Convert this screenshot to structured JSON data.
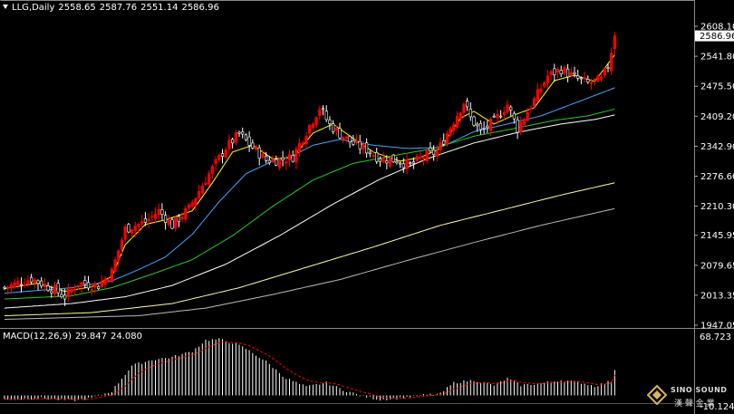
{
  "header": {
    "symbol": "LLG,Daily",
    "open": "2558.65",
    "high": "2587.76",
    "low": "2551.14",
    "close": "2586.96"
  },
  "macd_header": {
    "label": "MACD(12,26,9)",
    "macd": "29.847",
    "signal": "24.080"
  },
  "watermark": {
    "brand": "SINO SOUND",
    "sub": "漢 聲 金 業"
  },
  "colors": {
    "background": "#000000",
    "up_candle": "#ff0000",
    "down_candle": "#ffffff",
    "ma5": "#ffff00",
    "ma20": "#3fa7ff",
    "ma40": "#22cc22",
    "ma60": "#ffffff",
    "ma120": "#ffff99",
    "ma200": "#bbbbbb",
    "macd_hist": "#ffffff",
    "macd_signal": "#ff0000"
  },
  "chart_data": {
    "type": "candlestick",
    "price_axis": {
      "ticks": [
        "2608.10",
        "2541.80",
        "2475.50",
        "2409.20",
        "2342.90",
        "2276.60",
        "2210.30",
        "2145.95",
        "2079.65",
        "2013.35",
        "1947.05"
      ],
      "ylim": [
        1947.05,
        2608.1
      ]
    },
    "current_price_label": "2586.96",
    "anchors": {
      "close": [
        [
          0,
          2030
        ],
        [
          8,
          2050
        ],
        [
          15,
          2025
        ],
        [
          18,
          2010
        ],
        [
          22,
          2040
        ],
        [
          28,
          2035
        ],
        [
          32,
          2065
        ],
        [
          36,
          2160
        ],
        [
          42,
          2175
        ],
        [
          46,
          2200
        ],
        [
          50,
          2168
        ],
        [
          55,
          2205
        ],
        [
          60,
          2270
        ],
        [
          66,
          2340
        ],
        [
          70,
          2370
        ],
        [
          74,
          2340
        ],
        [
          78,
          2312
        ],
        [
          82,
          2312
        ],
        [
          86,
          2320
        ],
        [
          90,
          2375
        ],
        [
          94,
          2428
        ],
        [
          97,
          2390
        ],
        [
          100,
          2370
        ],
        [
          104,
          2348
        ],
        [
          108,
          2335
        ],
        [
          112,
          2315
        ],
        [
          117,
          2312
        ],
        [
          121,
          2300
        ],
        [
          125,
          2320
        ],
        [
          129,
          2330
        ],
        [
          133,
          2385
        ],
        [
          137,
          2440
        ],
        [
          139,
          2405
        ],
        [
          142,
          2375
        ],
        [
          146,
          2398
        ],
        [
          150,
          2435
        ],
        [
          153,
          2382
        ],
        [
          158,
          2445
        ],
        [
          162,
          2498
        ],
        [
          166,
          2513
        ],
        [
          170,
          2495
        ],
        [
          174,
          2482
        ],
        [
          178,
          2490
        ],
        [
          180,
          2520
        ],
        [
          182,
          2586.96
        ]
      ]
    },
    "ma_anchors": {
      "ma5": [
        [
          0,
          2028
        ],
        [
          10,
          2040
        ],
        [
          18,
          2022
        ],
        [
          26,
          2032
        ],
        [
          32,
          2055
        ],
        [
          36,
          2125
        ],
        [
          42,
          2170
        ],
        [
          48,
          2180
        ],
        [
          56,
          2200
        ],
        [
          62,
          2262
        ],
        [
          68,
          2330
        ],
        [
          74,
          2345
        ],
        [
          80,
          2315
        ],
        [
          86,
          2318
        ],
        [
          92,
          2372
        ],
        [
          98,
          2392
        ],
        [
          104,
          2360
        ],
        [
          110,
          2330
        ],
        [
          118,
          2310
        ],
        [
          124,
          2318
        ],
        [
          130,
          2338
        ],
        [
          136,
          2405
        ],
        [
          140,
          2420
        ],
        [
          146,
          2392
        ],
        [
          152,
          2412
        ],
        [
          158,
          2428
        ],
        [
          164,
          2488
        ],
        [
          170,
          2500
        ],
        [
          176,
          2486
        ],
        [
          182,
          2545
        ]
      ],
      "ma20": [
        [
          0,
          2018
        ],
        [
          20,
          2030
        ],
        [
          32,
          2045
        ],
        [
          40,
          2070
        ],
        [
          48,
          2098
        ],
        [
          56,
          2148
        ],
        [
          64,
          2220
        ],
        [
          72,
          2282
        ],
        [
          80,
          2310
        ],
        [
          86,
          2322
        ],
        [
          92,
          2345
        ],
        [
          100,
          2358
        ],
        [
          110,
          2345
        ],
        [
          120,
          2338
        ],
        [
          130,
          2340
        ],
        [
          140,
          2375
        ],
        [
          150,
          2392
        ],
        [
          160,
          2410
        ],
        [
          170,
          2438
        ],
        [
          182,
          2472
        ]
      ],
      "ma40": [
        [
          0,
          2005
        ],
        [
          20,
          2012
        ],
        [
          32,
          2030
        ],
        [
          44,
          2060
        ],
        [
          56,
          2092
        ],
        [
          68,
          2145
        ],
        [
          80,
          2210
        ],
        [
          92,
          2268
        ],
        [
          104,
          2305
        ],
        [
          116,
          2322
        ],
        [
          128,
          2338
        ],
        [
          140,
          2365
        ],
        [
          152,
          2382
        ],
        [
          164,
          2400
        ],
        [
          174,
          2410
        ],
        [
          182,
          2425
        ]
      ],
      "ma60": [
        [
          0,
          1985
        ],
        [
          20,
          1995
        ],
        [
          36,
          2010
        ],
        [
          50,
          2035
        ],
        [
          66,
          2082
        ],
        [
          82,
          2145
        ],
        [
          98,
          2215
        ],
        [
          112,
          2270
        ],
        [
          126,
          2315
        ],
        [
          140,
          2350
        ],
        [
          154,
          2375
        ],
        [
          166,
          2392
        ],
        [
          176,
          2402
        ],
        [
          182,
          2412
        ]
      ],
      "ma120": [
        [
          0,
          1968
        ],
        [
          26,
          1975
        ],
        [
          50,
          1995
        ],
        [
          70,
          2030
        ],
        [
          90,
          2075
        ],
        [
          110,
          2120
        ],
        [
          130,
          2168
        ],
        [
          150,
          2205
        ],
        [
          166,
          2235
        ],
        [
          182,
          2262
        ]
      ],
      "ma200": [
        [
          0,
          1960
        ],
        [
          40,
          1968
        ],
        [
          60,
          1985
        ],
        [
          80,
          2015
        ],
        [
          100,
          2048
        ],
        [
          120,
          2090
        ],
        [
          140,
          2130
        ],
        [
          160,
          2168
        ],
        [
          182,
          2205
        ]
      ]
    },
    "macd_axis": {
      "ticks": [
        "68.723",
        "-10.124"
      ],
      "ylim": [
        -10.124,
        68.723
      ]
    },
    "macd_anchors": [
      [
        0,
        -5
      ],
      [
        10,
        -3
      ],
      [
        20,
        -6
      ],
      [
        26,
        -3
      ],
      [
        32,
        5
      ],
      [
        38,
        35
      ],
      [
        44,
        42
      ],
      [
        50,
        45
      ],
      [
        56,
        52
      ],
      [
        60,
        65
      ],
      [
        64,
        66
      ],
      [
        68,
        62
      ],
      [
        72,
        55
      ],
      [
        78,
        40
      ],
      [
        84,
        20
      ],
      [
        90,
        10
      ],
      [
        96,
        15
      ],
      [
        100,
        8
      ],
      [
        106,
        0
      ],
      [
        112,
        -5
      ],
      [
        118,
        -3
      ],
      [
        124,
        0
      ],
      [
        130,
        2
      ],
      [
        134,
        15
      ],
      [
        140,
        18
      ],
      [
        146,
        12
      ],
      [
        150,
        20
      ],
      [
        154,
        12
      ],
      [
        160,
        14
      ],
      [
        166,
        18
      ],
      [
        172,
        15
      ],
      [
        176,
        11
      ],
      [
        182,
        18
      ]
    ]
  }
}
